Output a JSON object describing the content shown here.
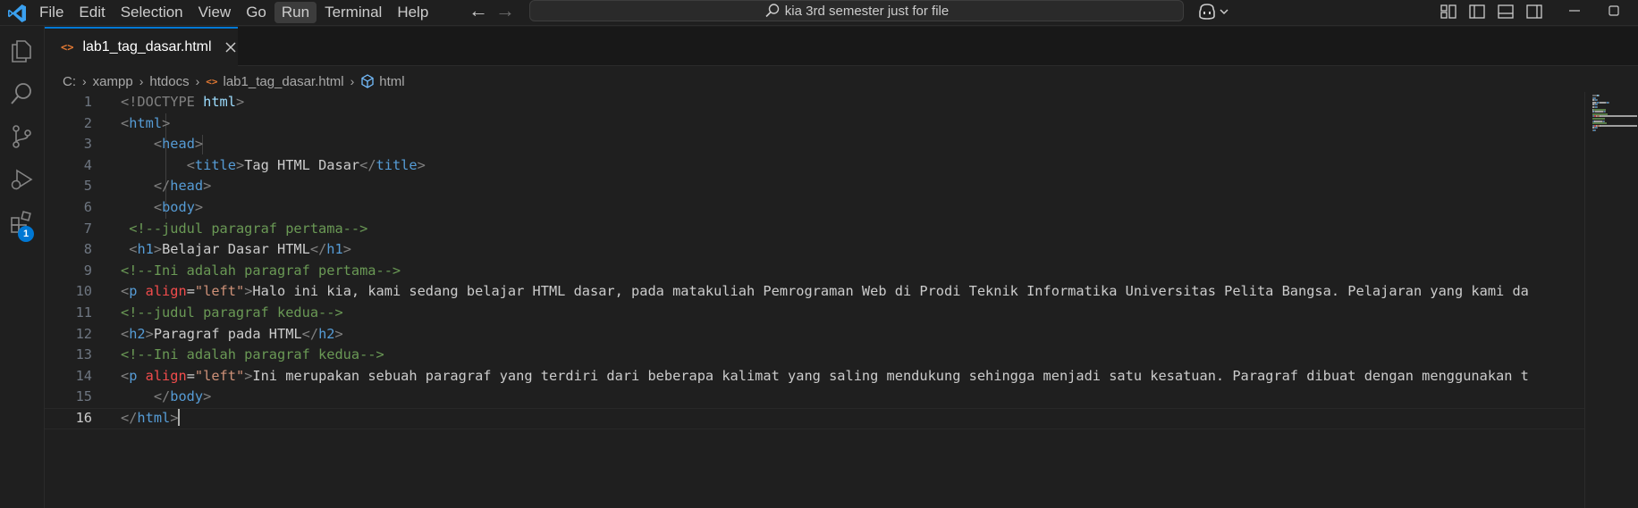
{
  "menu": {
    "items": [
      {
        "label": "File",
        "active": false
      },
      {
        "label": "Edit",
        "active": false
      },
      {
        "label": "Selection",
        "active": false
      },
      {
        "label": "View",
        "active": false
      },
      {
        "label": "Go",
        "active": false
      },
      {
        "label": "Run",
        "active": true
      },
      {
        "label": "Terminal",
        "active": false
      },
      {
        "label": "Help",
        "active": false
      }
    ]
  },
  "command_center": {
    "text": "kia 3rd semester just for file"
  },
  "activity_bar": {
    "items": [
      "explorer-icon",
      "search-icon",
      "source-control-icon",
      "run-debug-icon",
      "extensions-icon"
    ],
    "extensions_badge": "1"
  },
  "tabs": [
    {
      "label": "lab1_tag_dasar.html",
      "icon": "<>",
      "active": true
    }
  ],
  "breadcrumb": {
    "items": [
      "C:",
      "xampp",
      "htdocs"
    ],
    "file": "lab1_tag_dasar.html",
    "file_icon": "<>",
    "symbol": "html"
  },
  "editor": {
    "current_line": 16,
    "lines": [
      {
        "n": "1",
        "tokens": [
          {
            "t": "<!DOCTYPE ",
            "c": "#808080"
          },
          {
            "t": "html",
            "c": "#9cdcfe"
          },
          {
            "t": ">",
            "c": "#808080"
          }
        ]
      },
      {
        "n": "2",
        "tokens": [
          {
            "t": "<",
            "c": "#808080"
          },
          {
            "t": "html",
            "c": "#569cd6"
          },
          {
            "t": ">",
            "c": "#808080"
          }
        ]
      },
      {
        "n": "3",
        "tokens": [
          {
            "t": "    ",
            "c": "#cccccc"
          },
          {
            "t": "<",
            "c": "#808080"
          },
          {
            "t": "head",
            "c": "#569cd6"
          },
          {
            "t": ">",
            "c": "#808080"
          }
        ]
      },
      {
        "n": "4",
        "tokens": [
          {
            "t": "        ",
            "c": "#cccccc"
          },
          {
            "t": "<",
            "c": "#808080"
          },
          {
            "t": "title",
            "c": "#569cd6"
          },
          {
            "t": ">",
            "c": "#808080"
          },
          {
            "t": "Tag HTML Dasar",
            "c": "#cccccc"
          },
          {
            "t": "</",
            "c": "#808080"
          },
          {
            "t": "title",
            "c": "#569cd6"
          },
          {
            "t": ">",
            "c": "#808080"
          }
        ]
      },
      {
        "n": "5",
        "tokens": [
          {
            "t": "    ",
            "c": "#cccccc"
          },
          {
            "t": "</",
            "c": "#808080"
          },
          {
            "t": "head",
            "c": "#569cd6"
          },
          {
            "t": ">",
            "c": "#808080"
          }
        ]
      },
      {
        "n": "6",
        "tokens": [
          {
            "t": "    ",
            "c": "#cccccc"
          },
          {
            "t": "<",
            "c": "#808080"
          },
          {
            "t": "body",
            "c": "#569cd6"
          },
          {
            "t": ">",
            "c": "#808080"
          }
        ]
      },
      {
        "n": "7",
        "tokens": [
          {
            "t": " ",
            "c": "#cccccc"
          },
          {
            "t": "<!--judul paragraf pertama-->",
            "c": "#6a9955"
          }
        ]
      },
      {
        "n": "8",
        "tokens": [
          {
            "t": " ",
            "c": "#cccccc"
          },
          {
            "t": "<",
            "c": "#808080"
          },
          {
            "t": "h1",
            "c": "#569cd6"
          },
          {
            "t": ">",
            "c": "#808080"
          },
          {
            "t": "Belajar Dasar HTML",
            "c": "#cccccc"
          },
          {
            "t": "</",
            "c": "#808080"
          },
          {
            "t": "h1",
            "c": "#569cd6"
          },
          {
            "t": ">",
            "c": "#808080"
          }
        ]
      },
      {
        "n": "9",
        "tokens": [
          {
            "t": "<!--Ini adalah paragraf pertama-->",
            "c": "#6a9955"
          }
        ]
      },
      {
        "n": "10",
        "tokens": [
          {
            "t": "<",
            "c": "#808080"
          },
          {
            "t": "p ",
            "c": "#569cd6"
          },
          {
            "t": "align",
            "c": "#f14c4c"
          },
          {
            "t": "=",
            "c": "#cccccc"
          },
          {
            "t": "\"left\"",
            "c": "#ce9178"
          },
          {
            "t": ">",
            "c": "#808080"
          },
          {
            "t": "Halo ini kia, kami sedang belajar HTML dasar, pada matakuliah Pemrograman Web di Prodi Teknik Informatika Universitas Pelita Bangsa. Pelajaran yang kami da",
            "c": "#cccccc"
          }
        ]
      },
      {
        "n": "11",
        "tokens": [
          {
            "t": "<!--judul paragraf kedua-->",
            "c": "#6a9955"
          }
        ]
      },
      {
        "n": "12",
        "tokens": [
          {
            "t": "<",
            "c": "#808080"
          },
          {
            "t": "h2",
            "c": "#569cd6"
          },
          {
            "t": ">",
            "c": "#808080"
          },
          {
            "t": "Paragraf pada HTML",
            "c": "#cccccc"
          },
          {
            "t": "</",
            "c": "#808080"
          },
          {
            "t": "h2",
            "c": "#569cd6"
          },
          {
            "t": ">",
            "c": "#808080"
          }
        ]
      },
      {
        "n": "13",
        "tokens": [
          {
            "t": "<!--Ini adalah paragraf kedua-->",
            "c": "#6a9955"
          }
        ]
      },
      {
        "n": "14",
        "tokens": [
          {
            "t": "<",
            "c": "#808080"
          },
          {
            "t": "p ",
            "c": "#569cd6"
          },
          {
            "t": "align",
            "c": "#f14c4c"
          },
          {
            "t": "=",
            "c": "#cccccc"
          },
          {
            "t": "\"left\"",
            "c": "#ce9178"
          },
          {
            "t": ">",
            "c": "#808080"
          },
          {
            "t": "Ini merupakan sebuah paragraf yang terdiri dari beberapa kalimat yang saling mendukung sehingga menjadi satu kesatuan. Paragraf dibuat dengan menggunakan t",
            "c": "#cccccc"
          }
        ]
      },
      {
        "n": "15",
        "tokens": [
          {
            "t": "    ",
            "c": "#cccccc"
          },
          {
            "t": "</",
            "c": "#808080"
          },
          {
            "t": "body",
            "c": "#569cd6"
          },
          {
            "t": ">",
            "c": "#808080"
          }
        ]
      },
      {
        "n": "16",
        "tokens": [
          {
            "t": "</",
            "c": "#808080"
          },
          {
            "t": "html",
            "c": "#569cd6"
          },
          {
            "t": ">",
            "c": "#808080"
          }
        ]
      }
    ]
  },
  "colors": {
    "accent": "#0078d4",
    "editor_bg": "#1f1f1f",
    "file_icon": "#e37933"
  }
}
